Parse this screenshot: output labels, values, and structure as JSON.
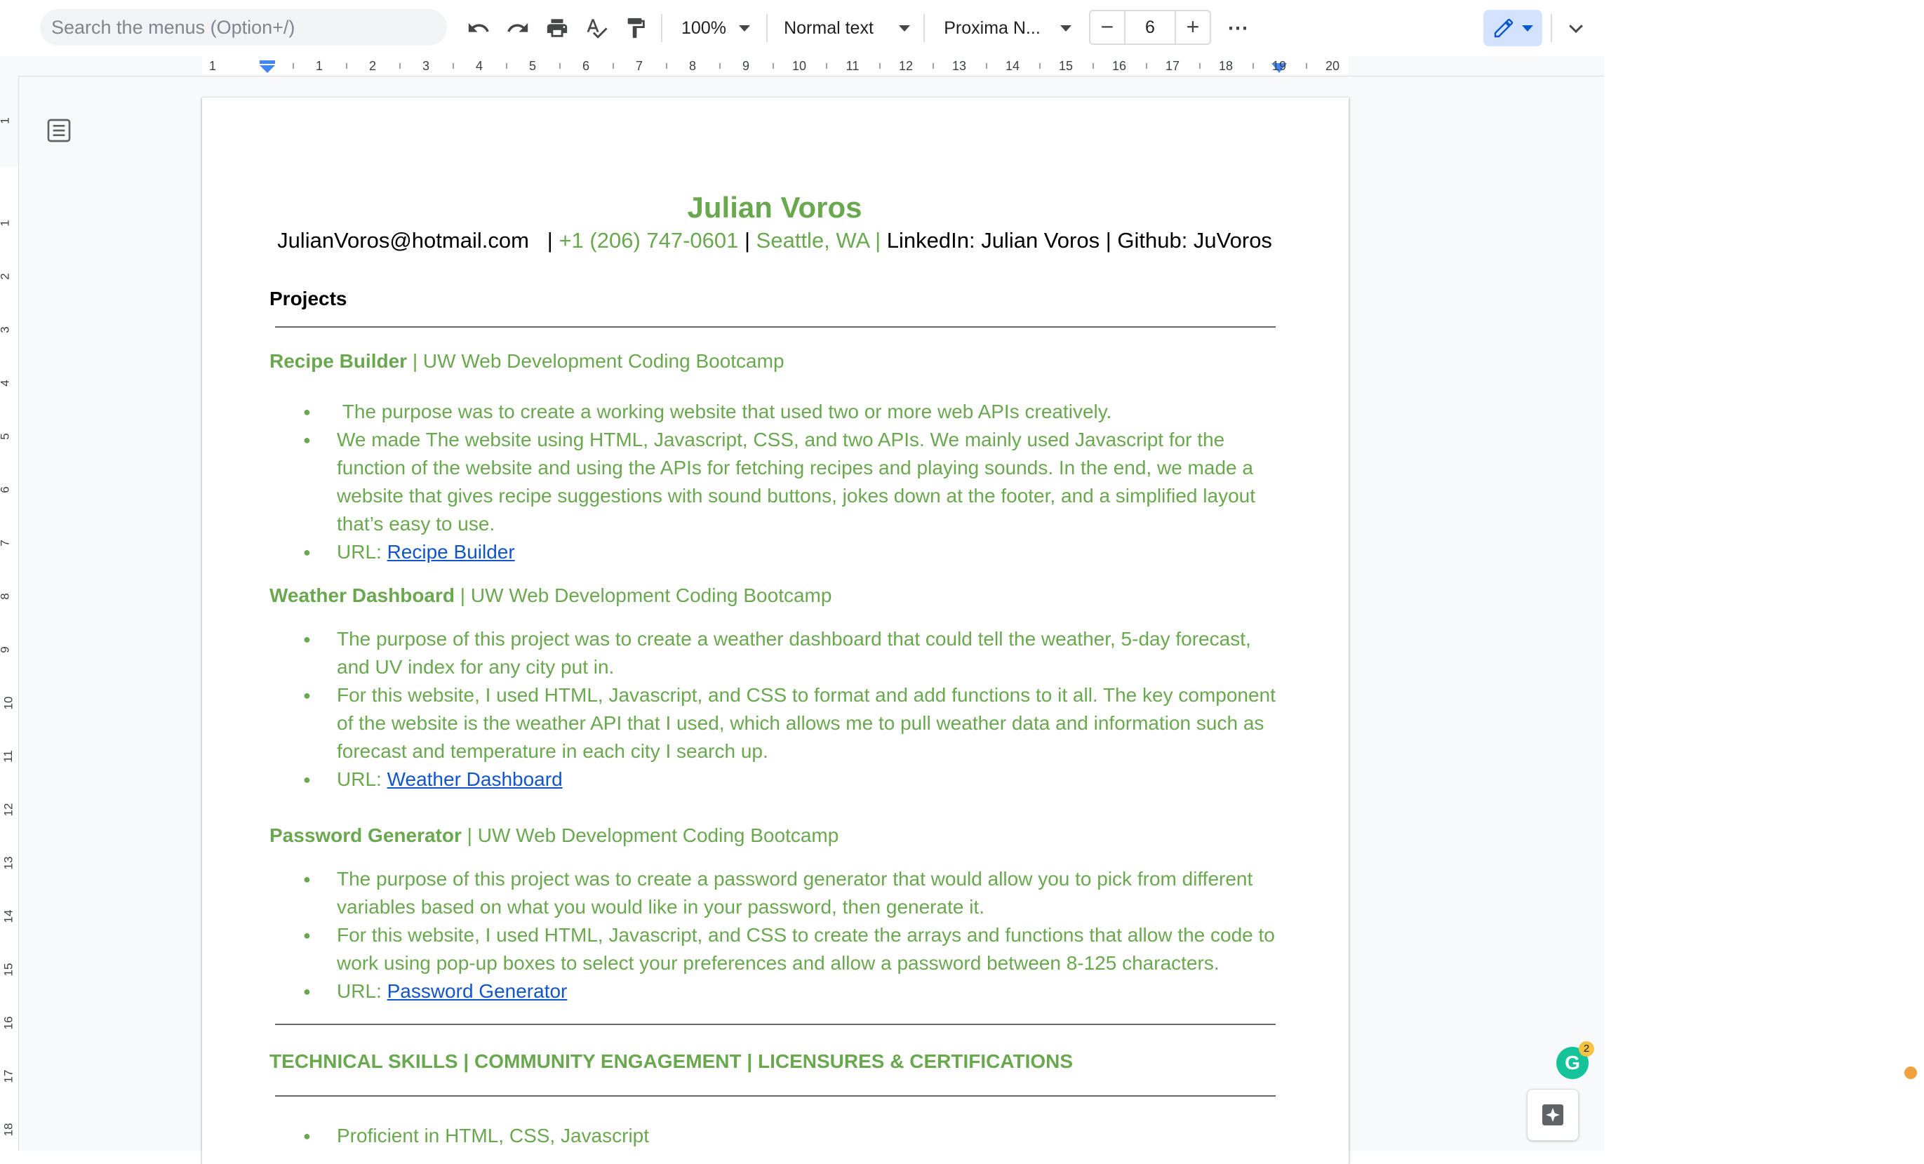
{
  "toolbar": {
    "search_placeholder": "Search the menus (Option+/)",
    "zoom": "100%",
    "style": "Normal text",
    "font": "Proxima N...",
    "font_size": "6",
    "minus": "−",
    "plus": "+",
    "more": "⋯"
  },
  "ruler": {
    "ticks": [
      "1",
      "1",
      "2",
      "3",
      "4",
      "5",
      "6",
      "7",
      "8",
      "9",
      "10",
      "11",
      "12",
      "13",
      "14",
      "15",
      "16",
      "17",
      "18",
      "19",
      "20"
    ]
  },
  "vruler": {
    "ticks": [
      "1",
      "1",
      "2",
      "3",
      "4",
      "5",
      "6",
      "7",
      "8",
      "9",
      "10",
      "11",
      "12",
      "13",
      "14",
      "15",
      "16",
      "17",
      "18"
    ]
  },
  "doc": {
    "name": "Julian Voros",
    "contact": {
      "email": "JulianVoros@hotmail.com",
      "sep1": "   | ",
      "phone": "+1 (206) 747-0601",
      "sep2": " | ",
      "location": "Seattle, WA",
      "sep3": " | ",
      "linkedin": "LinkedIn: Julian Voros",
      "sep4": " | ",
      "github": "Github: JuVoros"
    },
    "projects_heading": "Projects",
    "projects": [
      {
        "name": "Recipe Builder",
        "sep": " | ",
        "org": "UW Web Development Coding Bootcamp",
        "bullets": [
          " The purpose was to create a working website that used two or more web APIs creatively.",
          "We made The website using HTML, Javascript, CSS, and two APIs. We mainly used Javascript for the function of the website and using the APIs for fetching recipes and playing sounds. In the end, we made a website that gives recipe suggestions with sound buttons, jokes down at the footer, and a simplified layout that’s easy to use."
        ],
        "url_label": "URL: ",
        "url_text": "Recipe Builder"
      },
      {
        "name": "Weather Dashboard",
        "sep": " | ",
        "org": "UW Web Development Coding Bootcamp",
        "bullets": [
          "The purpose of this project was to create a weather dashboard that could tell the weather, 5-day forecast, and UV index for any city put in.",
          "For this website, I used HTML, Javascript, and CSS to format and add functions to it all. The key component of the website is the weather API that I used, which allows me to pull weather data and information such as forecast and temperature in each city I search up."
        ],
        "url_label": "URL: ",
        "url_text": "Weather Dashboard"
      },
      {
        "name": "Password Generator",
        "sep": " | ",
        "org": "UW Web Development Coding Bootcamp",
        "bullets": [
          "The purpose of this project was to create a password generator that would allow you to pick from different variables based on what you would like in your password, then generate it.",
          "For this website, I used HTML, Javascript, and CSS to create the arrays and functions that allow the code to work using pop-up boxes to select your preferences and allow a password between 8-125 characters."
        ],
        "url_label": "URL: ",
        "url_text": "Password Generator"
      }
    ],
    "skills_heading": "TECHNICAL SKILLS | COMMUNITY ENGAGEMENT | LICENSURES & CERTIFICATIONS",
    "skills": [
      "Proficient in HTML, CSS, Javascript"
    ]
  },
  "widgets": {
    "grammarly_letter": "G",
    "grammarly_count": "2"
  },
  "colors": {
    "accent_green": "#6aa84f",
    "link_blue": "#1155cc"
  }
}
